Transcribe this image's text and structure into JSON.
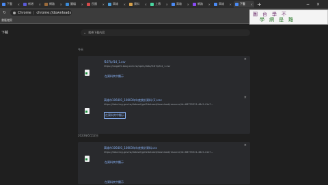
{
  "tabs": [
    {
      "label": "下載",
      "favicon": "#4a8af4"
    },
    {
      "label": "新增",
      "favicon": "#5a5ad6"
    },
    {
      "label": "網路",
      "favicon": "#9a6a3a"
    },
    {
      "label": "圖檔",
      "favicon": "#3a8ad6"
    },
    {
      "label": "民國",
      "favicon": "#d64a4a"
    },
    {
      "label": "高雄",
      "favicon": "#4a9ad6"
    },
    {
      "label": "資料",
      "favicon": "#d6a04a"
    },
    {
      "label": "上傳",
      "favicon": "#4ad6a0"
    },
    {
      "label": "高雄",
      "favicon": "#4a8af4"
    },
    {
      "label": "網路",
      "favicon": "#8a4af4"
    },
    {
      "label": "高雄",
      "favicon": "#4a8af4"
    },
    {
      "label": "下載",
      "favicon": "#4a8af4"
    }
  ],
  "active_tab_index": 11,
  "address": {
    "scheme": "Chrome",
    "path": "chrome://downloads"
  },
  "bookmarks_label": "書籤檔案",
  "page_title": "下載",
  "search_placeholder": "搜尋下載內容",
  "groups": [
    {
      "date": "今天"
    },
    {
      "date": "2023年6月12日"
    }
  ],
  "downloads": [
    {
      "name": "f167lpf14_1.csv",
      "url": "https://rosgalfe.bosy.com.tw/open/data/f167lpf14_1.csv",
      "action": "在資料夾中顯示"
    },
    {
      "name": "高雄市106401_10803年年底統計資料 (1).csv",
      "url": "https://data.kcg.gov.tw/dataset/get2dataset/download/resource/id=68755321-46c5-41e7...",
      "action": "在資料夾中顯示"
    },
    {
      "name": "高雄市106401_10803年年底統計資料.csv",
      "url": "https://data.kcg.gov.tw/dataset/get2dataset/download/resource/id=68755321-46c5-41e7...",
      "action": "在資料夾中顯示"
    },
    {
      "name": "",
      "url": "",
      "action": "在資料夾中顯示"
    }
  ],
  "overlay": {
    "line1": "圖　台　學　不",
    "line2": "學　網　是　難"
  }
}
